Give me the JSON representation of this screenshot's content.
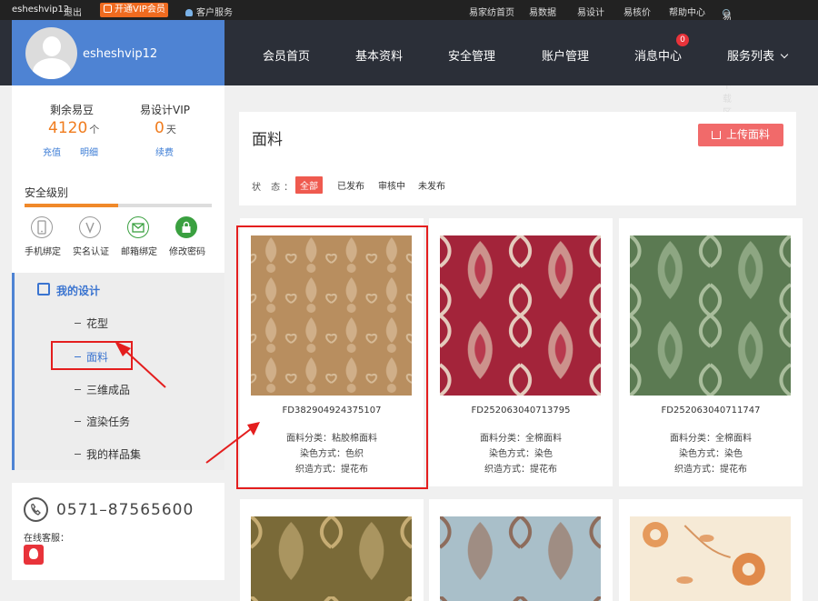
{
  "topbar": {
    "username": "esheshvip12",
    "logout": "退出",
    "vip_button": "开通VIP会员",
    "customer_service": "客户服务",
    "links": [
      "易家纺首页",
      "易数据",
      "易设计",
      "易核价",
      "帮助中心"
    ],
    "download": "易家纺软件下载区"
  },
  "profile": {
    "username": "esheshvip12"
  },
  "nav": {
    "items": [
      "会员首页",
      "基本资料",
      "安全管理",
      "账户管理",
      "消息中心",
      "服务列表"
    ],
    "message_count": "0"
  },
  "stats": {
    "beans_label": "剩余易豆",
    "beans_value": "4120",
    "beans_unit": "个",
    "recharge": "充值",
    "detail": "明细",
    "vip_label": "易设计VIP",
    "vip_value": "0",
    "vip_unit": "天",
    "renew": "续费"
  },
  "security": {
    "label": "安全级别",
    "level_fraction": 0.5,
    "items": [
      "手机绑定",
      "实名认证",
      "邮箱绑定",
      "修改密码"
    ]
  },
  "menu": {
    "head": "我的设计",
    "items": [
      "花型",
      "面料",
      "三维成品",
      "渲染任务",
      "我的样品集"
    ],
    "active_index": 1
  },
  "contact": {
    "phone": "0571–87565600",
    "online_label": "在线客服："
  },
  "main": {
    "title": "面料",
    "upload_button": "上传面料",
    "status_label": "状 态：",
    "filters": [
      "全部",
      "已发布",
      "审核中",
      "未发布"
    ],
    "active_filter": 0
  },
  "fabrics": [
    {
      "code": "FD382904924375107",
      "category": "面料分类：粘胶棉面料",
      "dye": "染色方式：色织",
      "weave": "织造方式：提花布"
    },
    {
      "code": "FD252063040713795",
      "category": "面料分类：全棉面料",
      "dye": "染色方式：染色",
      "weave": "织造方式：提花布"
    },
    {
      "code": "FD252063040711747",
      "category": "面料分类：全棉面料",
      "dye": "染色方式：染色",
      "weave": "织造方式：提花布"
    }
  ],
  "colors": {
    "accent_blue": "#4e83d3",
    "header_dark": "#2b2f38",
    "orange": "#f07c1e",
    "upload_red": "#f16a6a",
    "highlight_red": "#e41e1e"
  }
}
